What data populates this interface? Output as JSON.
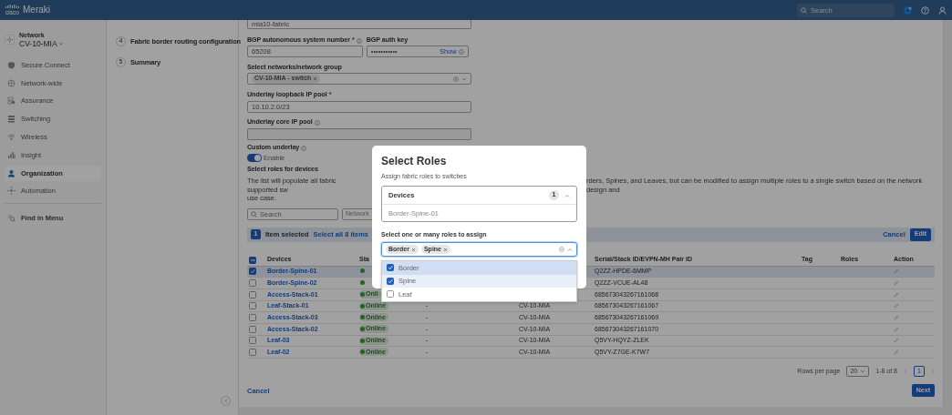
{
  "top_bar": {
    "logo_text": "cisco",
    "brand": "Meraki",
    "search": {
      "placeholder": "Search"
    }
  },
  "sidebar": {
    "network_label": "Network",
    "network": "CV-10-MIA",
    "items": [
      {
        "label": "Secure Connect",
        "selected": false
      },
      {
        "label": "Network-wide",
        "selected": false
      },
      {
        "label": "Assurance",
        "selected": false
      },
      {
        "label": "Switching",
        "selected": false
      },
      {
        "label": "Wireless",
        "selected": false
      },
      {
        "label": "Insight",
        "selected": false
      },
      {
        "label": "Organization",
        "selected": true
      },
      {
        "label": "Automation",
        "selected": false
      }
    ],
    "find": "Find in Menu"
  },
  "steps": [
    {
      "number": "4",
      "label": "Fabric border routing configuration"
    },
    {
      "number": "5",
      "label": "Summary"
    }
  ],
  "form": {
    "fabric_name": "mia10-fabric",
    "asn": {
      "label": "BGP autonomous system number",
      "required_mark": "*",
      "value": "65208"
    },
    "auth_key": {
      "label": "BGP auth key",
      "value": "•••••••••••",
      "show": "Show"
    },
    "networks": {
      "label": "Select networks/network group",
      "chip": "CV-10-MIA - switch"
    },
    "loopback": {
      "label": "Underlay loopback IP pool",
      "required_mark": "*",
      "value": "10.10.2.0/23"
    },
    "core": {
      "label": "Underlay core IP pool"
    },
    "custom_underlay": {
      "label": "Custom underlay",
      "toggle": "Enable",
      "on": true
    },
    "roles_title": "Select roles for devices",
    "description_left": "The list will populate all fabric supported sw",
    "description_right": "rders, Spines, and Leaves, but can be modified to assign multiple roles to a single switch based on the network design and",
    "description_line2": "use case."
  },
  "table": {
    "search": {
      "placeholder": "Search"
    },
    "filter": "Network",
    "selection": {
      "count": "1",
      "text": "Item selected",
      "select_all": "Select all 8 items",
      "cancel": "Cancel",
      "edit": "Edit"
    },
    "header_partial": true,
    "columns": [
      "Devices",
      "Sta",
      "Serial/Stack ID/EVPN-MH Pair ID",
      "Tag",
      "Roles",
      "Action"
    ],
    "rows": [
      {
        "selected": true,
        "device": "Border-Spine-01",
        "online": true,
        "serial": "Q2ZZ-HPDE-6MMP"
      },
      {
        "selected": false,
        "device": "Border-Spine-02",
        "online": true,
        "serial": "Q2ZZ-VCUE-AL48"
      },
      {
        "selected": false,
        "device": "Access-Stack-01",
        "online": true,
        "status": "Onli",
        "serial": "685673043267161068"
      },
      {
        "selected": false,
        "device": "Leaf-Stack-01",
        "online": true,
        "status": "Online",
        "column_3": "-",
        "network": "CV-10-MIA",
        "serial": "685673043267161067"
      },
      {
        "selected": false,
        "device": "Access-Stack-03",
        "online": true,
        "status": "Online",
        "column_3": "-",
        "network": "CV-10-MIA",
        "serial": "685673043267161069"
      },
      {
        "selected": false,
        "device": "Access-Stack-02",
        "online": true,
        "status": "Online",
        "column_3": "-",
        "network": "CV-10-MIA",
        "serial": "685673043267161070"
      },
      {
        "selected": false,
        "device": "Leaf-03",
        "online": true,
        "status": "Online",
        "column_3": "-",
        "network": "CV-10-MIA",
        "serial": "Q5VY-HQYZ-ZLEK"
      },
      {
        "selected": false,
        "device": "Leaf-02",
        "online": true,
        "status": "Online",
        "column_3": "-",
        "network": "CV-10-MIA",
        "serial": "Q5VY-Z7GE-K7W7"
      }
    ],
    "pagination": {
      "rows_label": "Rows per page",
      "rows_value": "20",
      "range": "1-8 of 8",
      "page": "1"
    }
  },
  "footer": {
    "cancel": "Cancel",
    "next": "Next"
  },
  "modal": {
    "title": "Select Roles",
    "subtitle": "Assign fabric roles to switches",
    "devices": {
      "label": "Devices",
      "count": "1",
      "items": [
        "Border-Spine-01"
      ]
    },
    "roles_label": "Select one or many roles to assign",
    "chips": [
      "Border",
      "Spine"
    ],
    "options": [
      {
        "label": "Border",
        "checked": true,
        "selected": true
      },
      {
        "label": "Spine",
        "checked": true,
        "selected": false
      },
      {
        "label": "Leaf",
        "checked": false,
        "selected": false
      }
    ]
  }
}
